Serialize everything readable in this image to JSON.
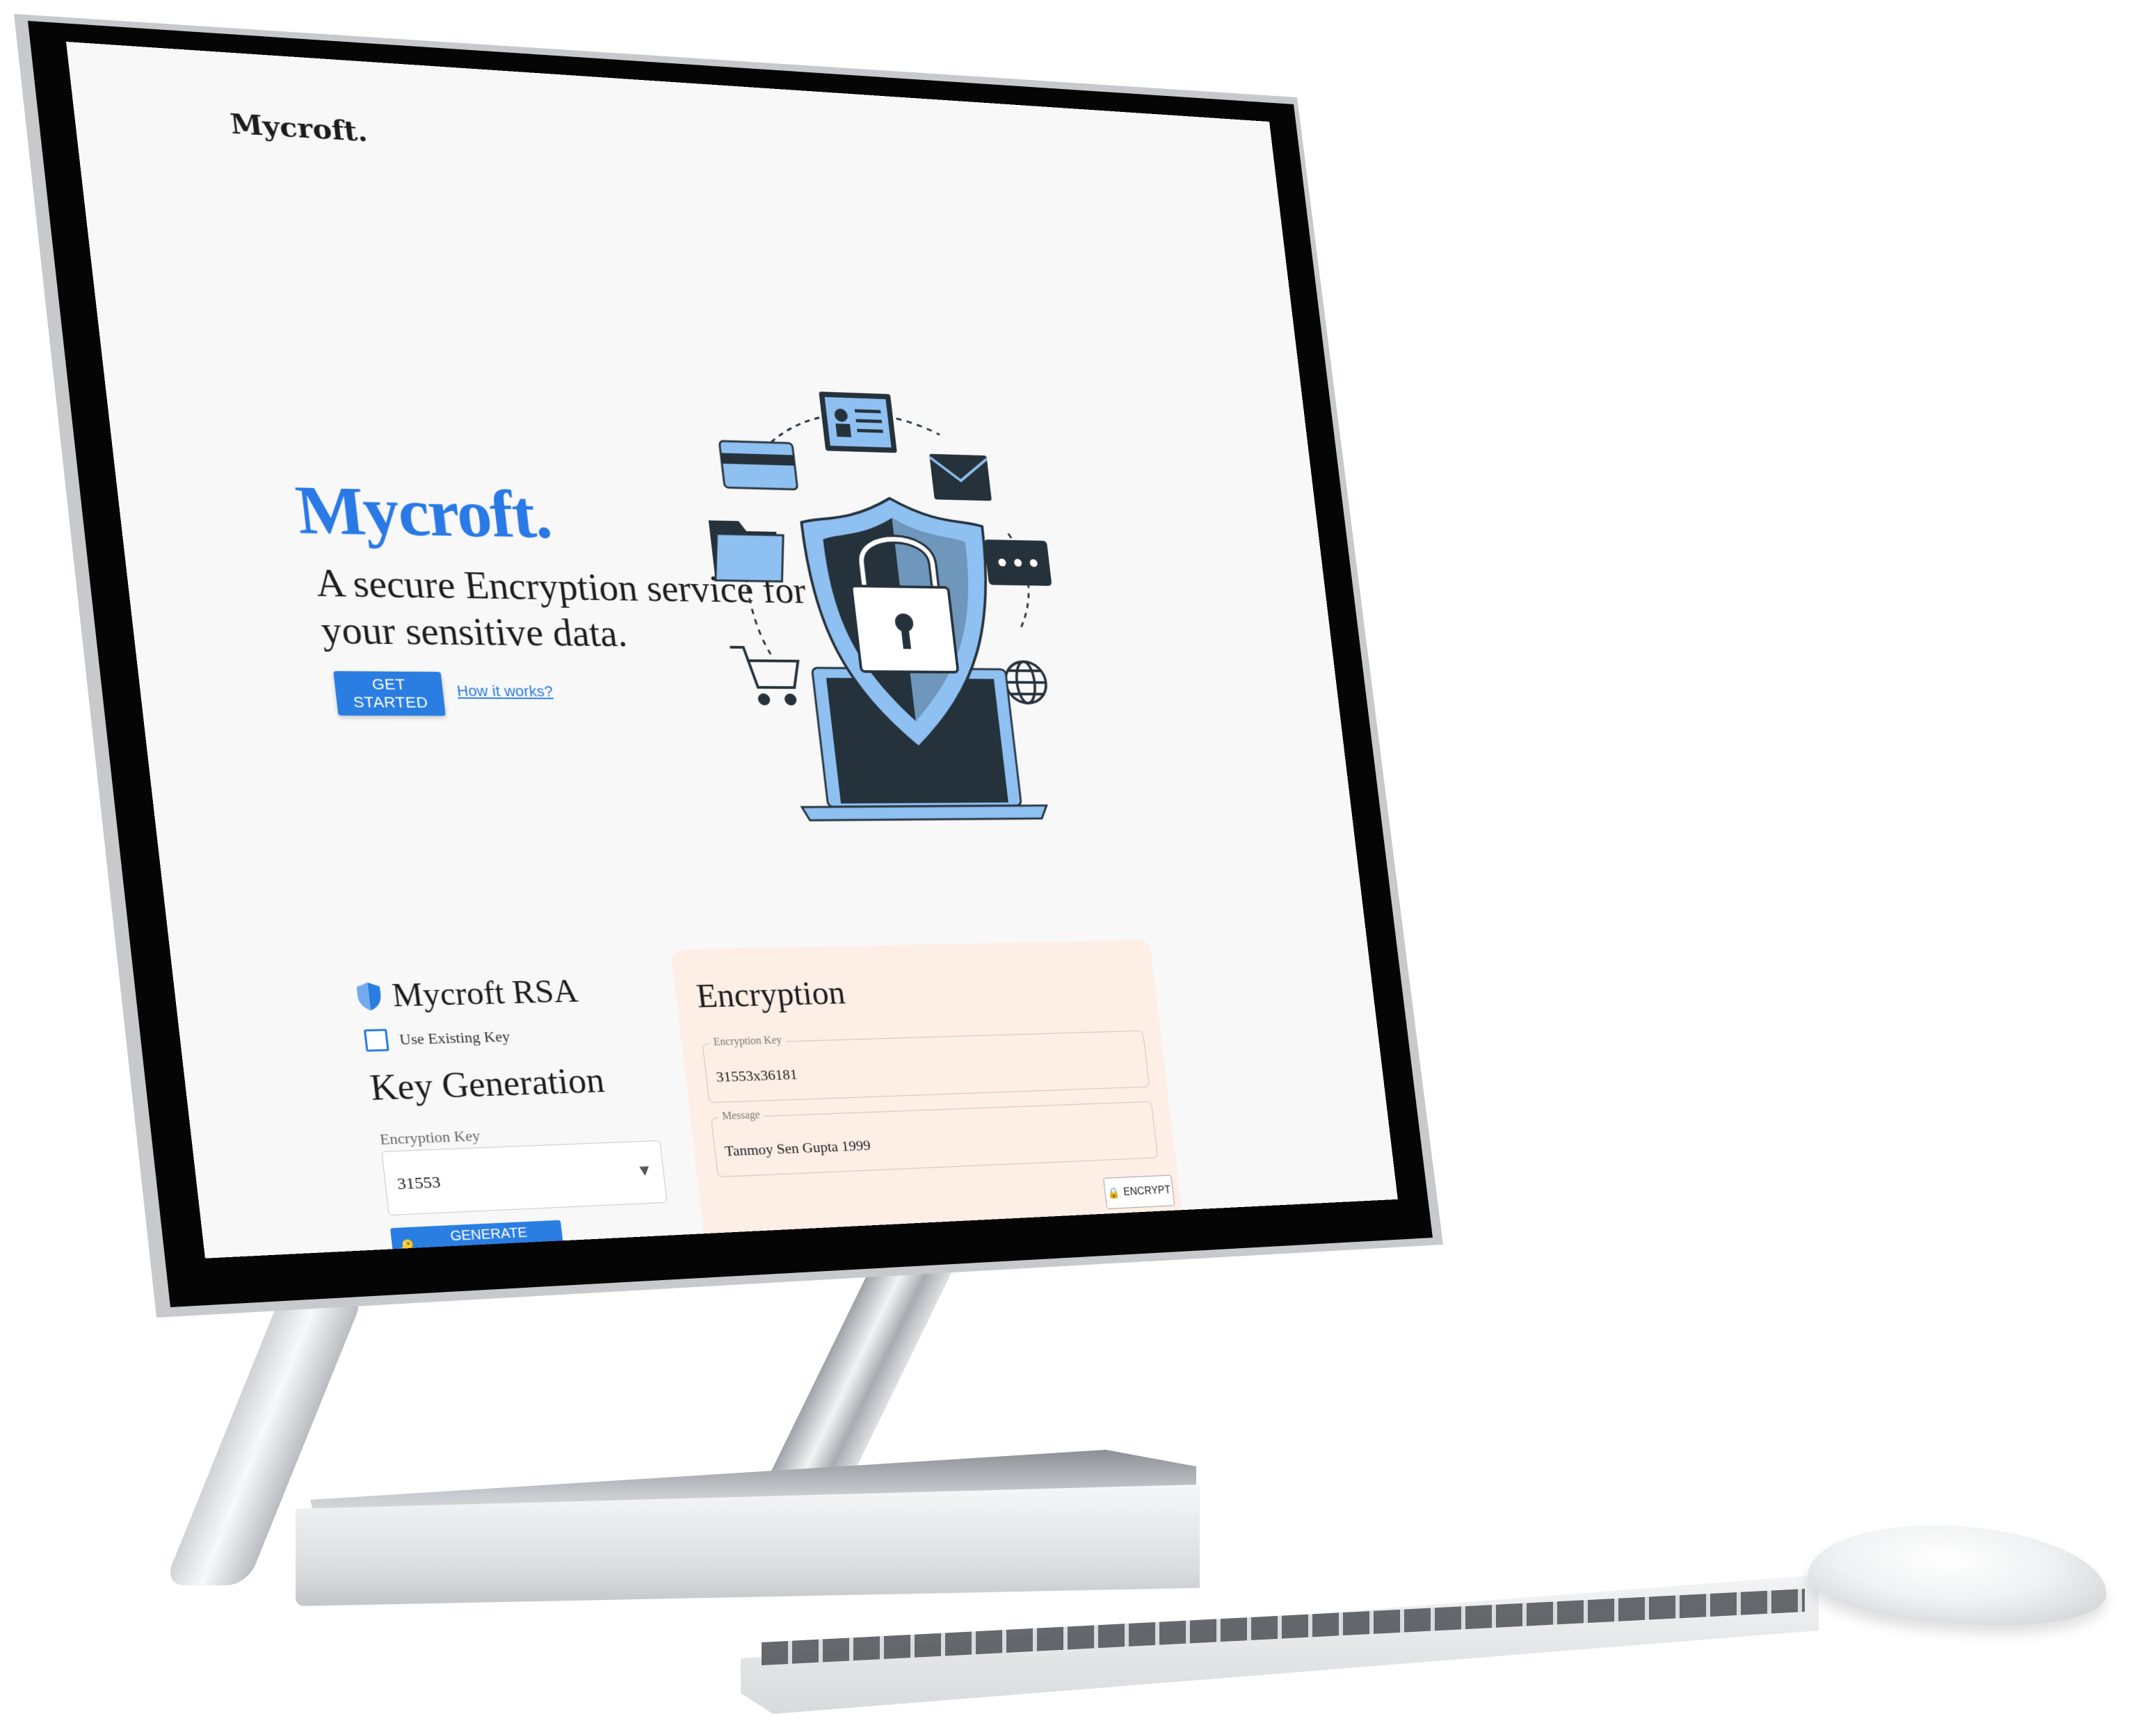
{
  "header": {
    "brand": "Mycroft."
  },
  "hero": {
    "title": "Mycroft.",
    "subtitle": "A secure Encryption service for all your sensitive data.",
    "get_started": "GET STARTED",
    "how_it_works": "How it works?"
  },
  "rsa": {
    "title": "Mycroft RSA",
    "use_existing_key": "Use Existing Key",
    "key_generation_title": "Key Generation",
    "encryption_key_label": "Encryption Key",
    "encryption_key_value": "31553",
    "generate_button": "GENERATE DECRYPTION KEY"
  },
  "encryption": {
    "title": "Encryption",
    "key_legend": "Encryption Key",
    "key_value": "31553x36181",
    "message_legend": "Message",
    "message_value": "Tanmoy Sen Gupta 1999",
    "encrypt_button": "ENCRYPT"
  },
  "colors": {
    "accent": "#2a7de1",
    "card_bg": "#fdeee6",
    "screen_bg": "#f8f8f8",
    "illustration_dark": "#26323b",
    "illustration_light": "#8fc0f2"
  }
}
